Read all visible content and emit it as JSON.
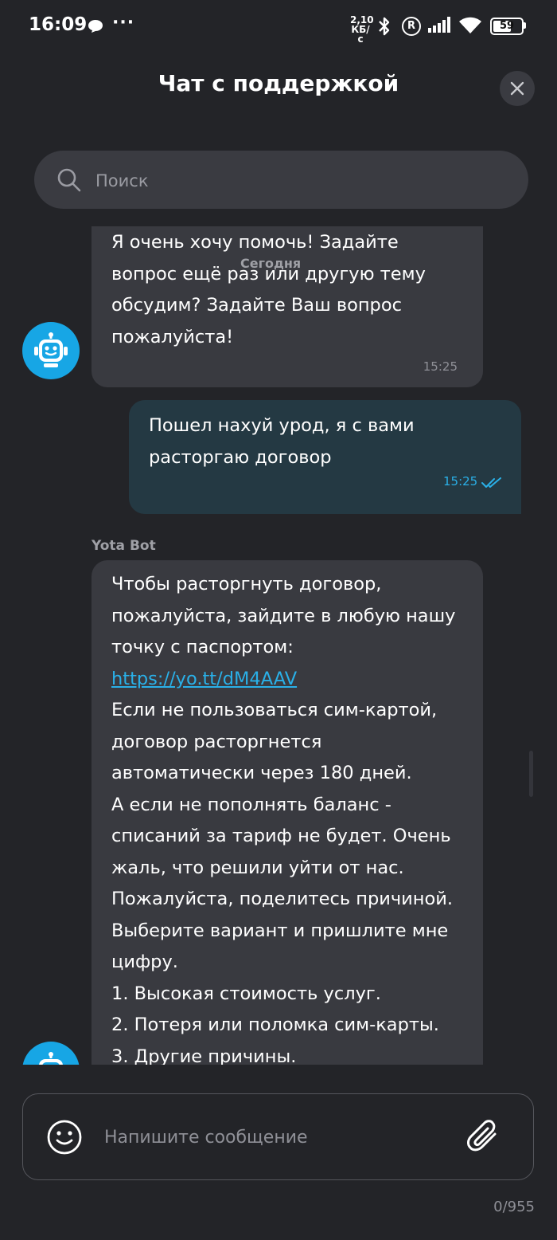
{
  "status_bar": {
    "time": "16:09",
    "speed_value": "2,10",
    "speed_unit": "КБ/с",
    "roaming": "R",
    "battery": "59"
  },
  "header": {
    "title": "Чат с поддержкой"
  },
  "search": {
    "placeholder": "Поиск"
  },
  "chat": {
    "date_chip": "Сегодня",
    "messages": [
      {
        "from": "bot",
        "text": "Я очень хочу помочь! Задайте\nвопрос ещё раз или другую тему\nобсудим? Задайте Ваш вопрос\nпожалуйста!",
        "time": "15:25"
      },
      {
        "from": "user",
        "text": "Пошел нахуй урод, я с вами\nрасторгаю договор",
        "time": "15:25",
        "status": "read"
      },
      {
        "from": "bot",
        "sender": "Yota Bot",
        "text_before_link": "Чтобы расторгнуть договор,\nпожалуйста, зайдите в любую нашу\nточку с паспортом:",
        "link": "https://yo.tt/dM4AAV",
        "text_after_link": "Если не пользоваться сим-картой,\nдоговор расторгнется\nавтоматически через 180 дней.\nА если не пополнять баланс -\nсписаний за тариф не будет. Очень\nжаль, что решили уйти от нас.\nПожалуйста, поделитесь причиной.\nВыберите вариант и пришлите мне\nцифру.\n1. Высокая стоимость услуг.\n2. Потеря или поломка сим-карты.\n3. Другие причины."
      }
    ]
  },
  "composer": {
    "placeholder": "Напишите сообщение",
    "counter": "0/955"
  },
  "colors": {
    "background": "#232428",
    "bot_bubble": "#393a40",
    "user_bubble": "#243943",
    "accent": "#2ab0e8",
    "avatar": "#17a6e5"
  },
  "icons": [
    "chat-bubble-icon",
    "bluetooth-icon",
    "signal-icon",
    "wifi-icon",
    "battery-icon",
    "close-icon",
    "search-icon",
    "robot-icon",
    "double-check-icon",
    "emoji-icon",
    "paperclip-icon"
  ]
}
